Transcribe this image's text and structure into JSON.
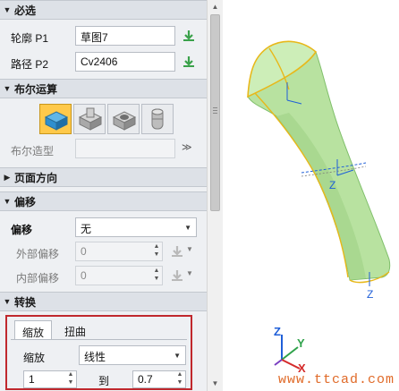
{
  "required": {
    "title": "必选",
    "profile_label": "轮廓 P1",
    "profile_value": "草图7",
    "path_label": "路径 P2",
    "path_value": "Cv2406"
  },
  "boolean": {
    "title": "布尔运算",
    "ops": [
      "base",
      "add",
      "subtract",
      "intersect"
    ],
    "boolean_shape_label": "布尔造型",
    "boolean_shape_value": ""
  },
  "page_direction": {
    "title": "页面方向"
  },
  "offset": {
    "title": "偏移",
    "offset_label": "偏移",
    "offset_value": "无",
    "outer_label": "外部偏移",
    "outer_value": "0",
    "inner_label": "内部偏移",
    "inner_value": "0"
  },
  "convert": {
    "title": "转换",
    "tabs": [
      "缩放",
      "扭曲"
    ],
    "scale_label": "缩放",
    "scale_value": "线性",
    "from_value": "1",
    "to_label": "到",
    "to_value": "0.7"
  },
  "viewport": {
    "axis_x": "X",
    "axis_y": "Y",
    "axis_z": "Z",
    "watermark": "www.ttcad.com"
  },
  "colors": {
    "accent_red": "#c0282d",
    "pick_green": "#3aa14a",
    "solid_green": "#b8e2a0",
    "edge_yellow": "#e8b81a",
    "axis_blue": "#1f5fd8"
  }
}
